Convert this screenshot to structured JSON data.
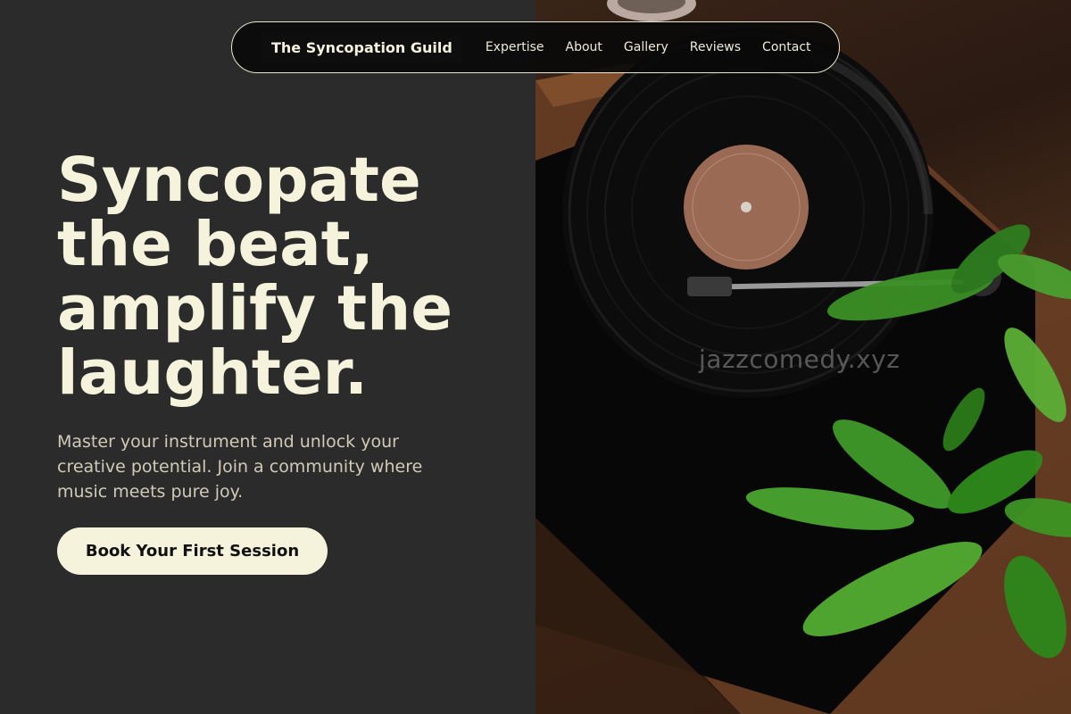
{
  "nav": {
    "brand": "The Syncopation Guild",
    "links": [
      "Expertise",
      "About",
      "Gallery",
      "Reviews",
      "Contact"
    ]
  },
  "hero": {
    "title": "Syncopate the beat, amplify the laughter.",
    "subtitle": "Master your instrument and unlock your creative potential. Join a community where music meets pure joy.",
    "cta_label": "Book Your First Session"
  },
  "image": {
    "subject": "record-player-with-plant",
    "watermark": "jazzcomedy.xyz"
  },
  "colors": {
    "background": "#2b2b2b",
    "accent": "#f6f3dd",
    "nav_border": "#e9e6d4"
  }
}
